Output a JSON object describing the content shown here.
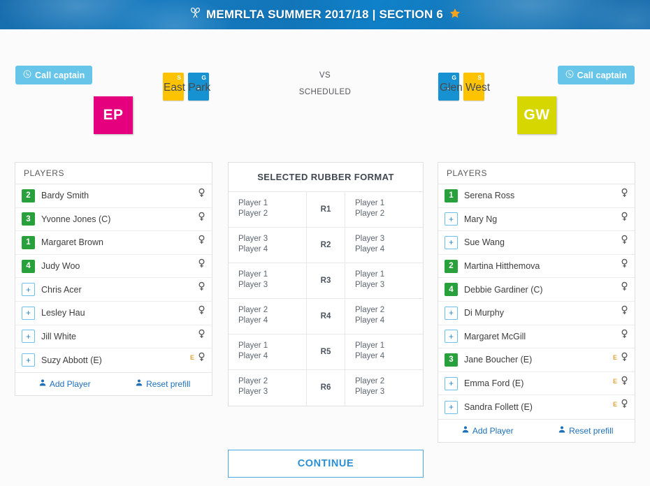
{
  "header": {
    "title": "MEMRLTA SUMMER 2017/18 | SECTION 6",
    "racquet_icon": "crossed-racquets-icon",
    "star_icon": "star-icon",
    "bg_color": "#1a7cc0"
  },
  "topbar": {
    "call_captain_left": "Call captain",
    "call_captain_right": "Call captain",
    "phone_icon": "phone-icon",
    "vs_label": "VS",
    "status_label": "SCHEDULED",
    "score_boxes_left": [
      {
        "letter": "S",
        "value": "-",
        "color": "#fdc300"
      },
      {
        "letter": "G",
        "value": "-",
        "color": "#1692d2"
      }
    ],
    "score_boxes_right": [
      {
        "letter": "G",
        "value": "-",
        "color": "#1692d2"
      },
      {
        "letter": "S",
        "value": "-",
        "color": "#fdc300"
      }
    ]
  },
  "teams": {
    "home": {
      "name": "East Park",
      "abbr": "EP",
      "color": "#e5007e"
    },
    "away": {
      "name": "Glen West",
      "abbr": "GW",
      "color": "#d6d600"
    }
  },
  "home_panel": {
    "header": "PLAYERS",
    "players": [
      {
        "badge": "2",
        "type": "num",
        "name": "Bardy Smith",
        "emark": "",
        "gender_icon": "venus-icon"
      },
      {
        "badge": "3",
        "type": "num",
        "name": "Yvonne Jones (C)",
        "emark": "",
        "gender_icon": "venus-icon"
      },
      {
        "badge": "1",
        "type": "num",
        "name": "Margaret Brown",
        "emark": "",
        "gender_icon": "venus-icon"
      },
      {
        "badge": "4",
        "type": "num",
        "name": "Judy Woo",
        "emark": "",
        "gender_icon": "venus-icon"
      },
      {
        "badge": "+",
        "type": "add",
        "name": "Chris Acer",
        "emark": "",
        "gender_icon": "venus-icon"
      },
      {
        "badge": "+",
        "type": "add",
        "name": "Lesley Hau",
        "emark": "",
        "gender_icon": "venus-icon"
      },
      {
        "badge": "+",
        "type": "add",
        "name": "Jill White",
        "emark": "",
        "gender_icon": "venus-icon"
      },
      {
        "badge": "+",
        "type": "add",
        "name": "Suzy Abbott (E)",
        "emark": "E",
        "gender_icon": "venus-icon"
      }
    ],
    "add_player": "Add Player",
    "reset_prefill": "Reset prefill"
  },
  "away_panel": {
    "header": "PLAYERS",
    "players": [
      {
        "badge": "1",
        "type": "num",
        "name": "Serena Ross",
        "emark": "",
        "gender_icon": "venus-icon"
      },
      {
        "badge": "+",
        "type": "add",
        "name": "Mary Ng",
        "emark": "",
        "gender_icon": "venus-icon"
      },
      {
        "badge": "+",
        "type": "add",
        "name": "Sue Wang",
        "emark": "",
        "gender_icon": "venus-icon"
      },
      {
        "badge": "2",
        "type": "num",
        "name": "Martina Hitthemova",
        "emark": "",
        "gender_icon": "venus-icon"
      },
      {
        "badge": "4",
        "type": "num",
        "name": "Debbie Gardiner (C)",
        "emark": "",
        "gender_icon": "venus-icon"
      },
      {
        "badge": "+",
        "type": "add",
        "name": "Di Murphy",
        "emark": "",
        "gender_icon": "venus-icon"
      },
      {
        "badge": "+",
        "type": "add",
        "name": "Margaret McGill",
        "emark": "",
        "gender_icon": "venus-icon"
      },
      {
        "badge": "3",
        "type": "num",
        "name": "Jane Boucher (E)",
        "emark": "E",
        "gender_icon": "venus-icon"
      },
      {
        "badge": "+",
        "type": "add",
        "name": "Emma Ford (E)",
        "emark": "E",
        "gender_icon": "venus-icon"
      },
      {
        "badge": "+",
        "type": "add",
        "name": "Sandra Follett (E)",
        "emark": "E",
        "gender_icon": "venus-icon"
      }
    ],
    "add_player": "Add Player",
    "reset_prefill": "Reset prefill"
  },
  "rubber_format": {
    "header": "SELECTED RUBBER FORMAT",
    "rows": [
      {
        "home": "Player 1\nPlayer 2",
        "rubber": "R1",
        "away": "Player 1\nPlayer 2"
      },
      {
        "home": "Player 3\nPlayer 4",
        "rubber": "R2",
        "away": "Player 3\nPlayer 4"
      },
      {
        "home": "Player 1\nPlayer 3",
        "rubber": "R3",
        "away": "Player 1\nPlayer 3"
      },
      {
        "home": "Player 2\nPlayer 4",
        "rubber": "R4",
        "away": "Player 2\nPlayer 4"
      },
      {
        "home": "Player 1\nPlayer 4",
        "rubber": "R5",
        "away": "Player 1\nPlayer 4"
      },
      {
        "home": "Player 2\nPlayer 3",
        "rubber": "R6",
        "away": "Player 2\nPlayer 3"
      }
    ]
  },
  "footer": {
    "continue_label": "CONTINUE"
  },
  "colors": {
    "accent_blue": "#2b8fd4",
    "light_blue": "#66c5e8",
    "badge_green": "#28a03c",
    "amber": "#fdc300",
    "link_blue": "#1d6fb8"
  }
}
